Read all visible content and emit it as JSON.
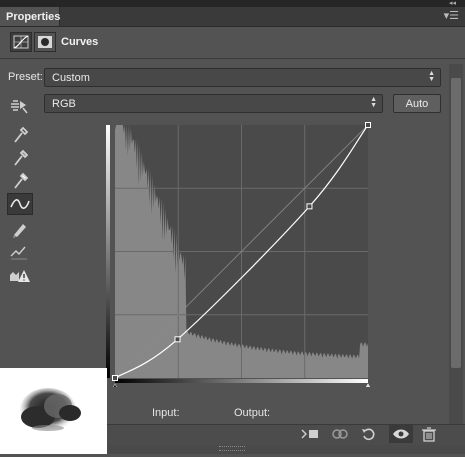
{
  "panel": {
    "tab_label": "Properties",
    "title": "Curves"
  },
  "preset": {
    "label": "Preset:",
    "value": "Custom"
  },
  "channel": {
    "value": "RGB"
  },
  "buttons": {
    "auto_label": "Auto"
  },
  "graph": {
    "input_label": "Input:",
    "output_label": "Output:",
    "range": [
      0,
      255
    ],
    "grid_divisions": 4,
    "curve_points": [
      {
        "input": 0,
        "output": 0
      },
      {
        "input": 63,
        "output": 39
      },
      {
        "input": 196,
        "output": 173
      },
      {
        "input": 255,
        "output": 255
      }
    ]
  },
  "tools": [
    {
      "name": "on-image-adjust-icon"
    },
    {
      "name": "black-point-eyedropper-icon"
    },
    {
      "name": "gray-point-eyedropper-icon"
    },
    {
      "name": "white-point-eyedropper-icon"
    },
    {
      "name": "curve-points-icon",
      "active": true
    },
    {
      "name": "pencil-draw-icon"
    },
    {
      "name": "smooth-curve-icon"
    },
    {
      "name": "clipping-warning-icon"
    }
  ],
  "bottom_bar": {
    "icons": [
      "clip-to-layer-icon",
      "view-previous-icon",
      "reset-icon",
      "visibility-eye-icon",
      "delete-trash-icon"
    ]
  },
  "colors": {
    "panel_bg": "#535353",
    "graph_bg": "#4a4a4a",
    "histogram": "#8a8a8a",
    "curve": "#ffffff"
  }
}
